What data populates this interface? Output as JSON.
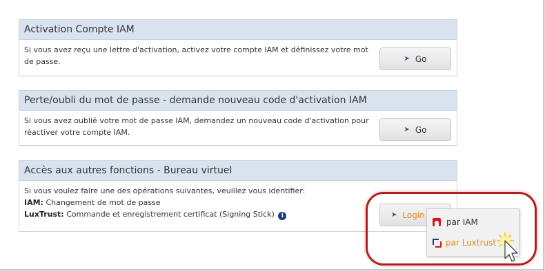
{
  "panels": [
    {
      "title": "Activation Compte IAM",
      "text": "Si vous avez reçu une lettre d'activation, activez votre compte IAM et définissez votre mot de passe.",
      "button": "Go"
    },
    {
      "title": "Perte/oubli du mot de passe - demande nouveau code d'activation IAM",
      "text": "Si vous avez oublié votre mot de passe IAM, demandez un nouveau code d'activation pour réactiver votre compte IAM.",
      "button": "Go"
    },
    {
      "title": "Accès aux autres fonctions - Bureau virtuel",
      "intro": "Si vous voulez faire une des opérations suivantes, veuillez vous identifier:",
      "line1_key": "IAM:",
      "line1_text": "Changement de mot de passe",
      "line2_key": "LuxTrust:",
      "line2_text": "Commande et enregistrement certificat (Signing Stick)",
      "button": "Login"
    }
  ],
  "login_menu": {
    "items": [
      {
        "label": "par IAM",
        "icon": "iam-logo-icon",
        "color": "#333333"
      },
      {
        "label": "par Luxtrust",
        "icon": "luxtrust-logo-icon",
        "color": "#e08a1e"
      }
    ]
  },
  "colors": {
    "panel_header": "#d9e3f0",
    "highlight": "#b41c1c",
    "link_orange": "#e08a1e"
  }
}
